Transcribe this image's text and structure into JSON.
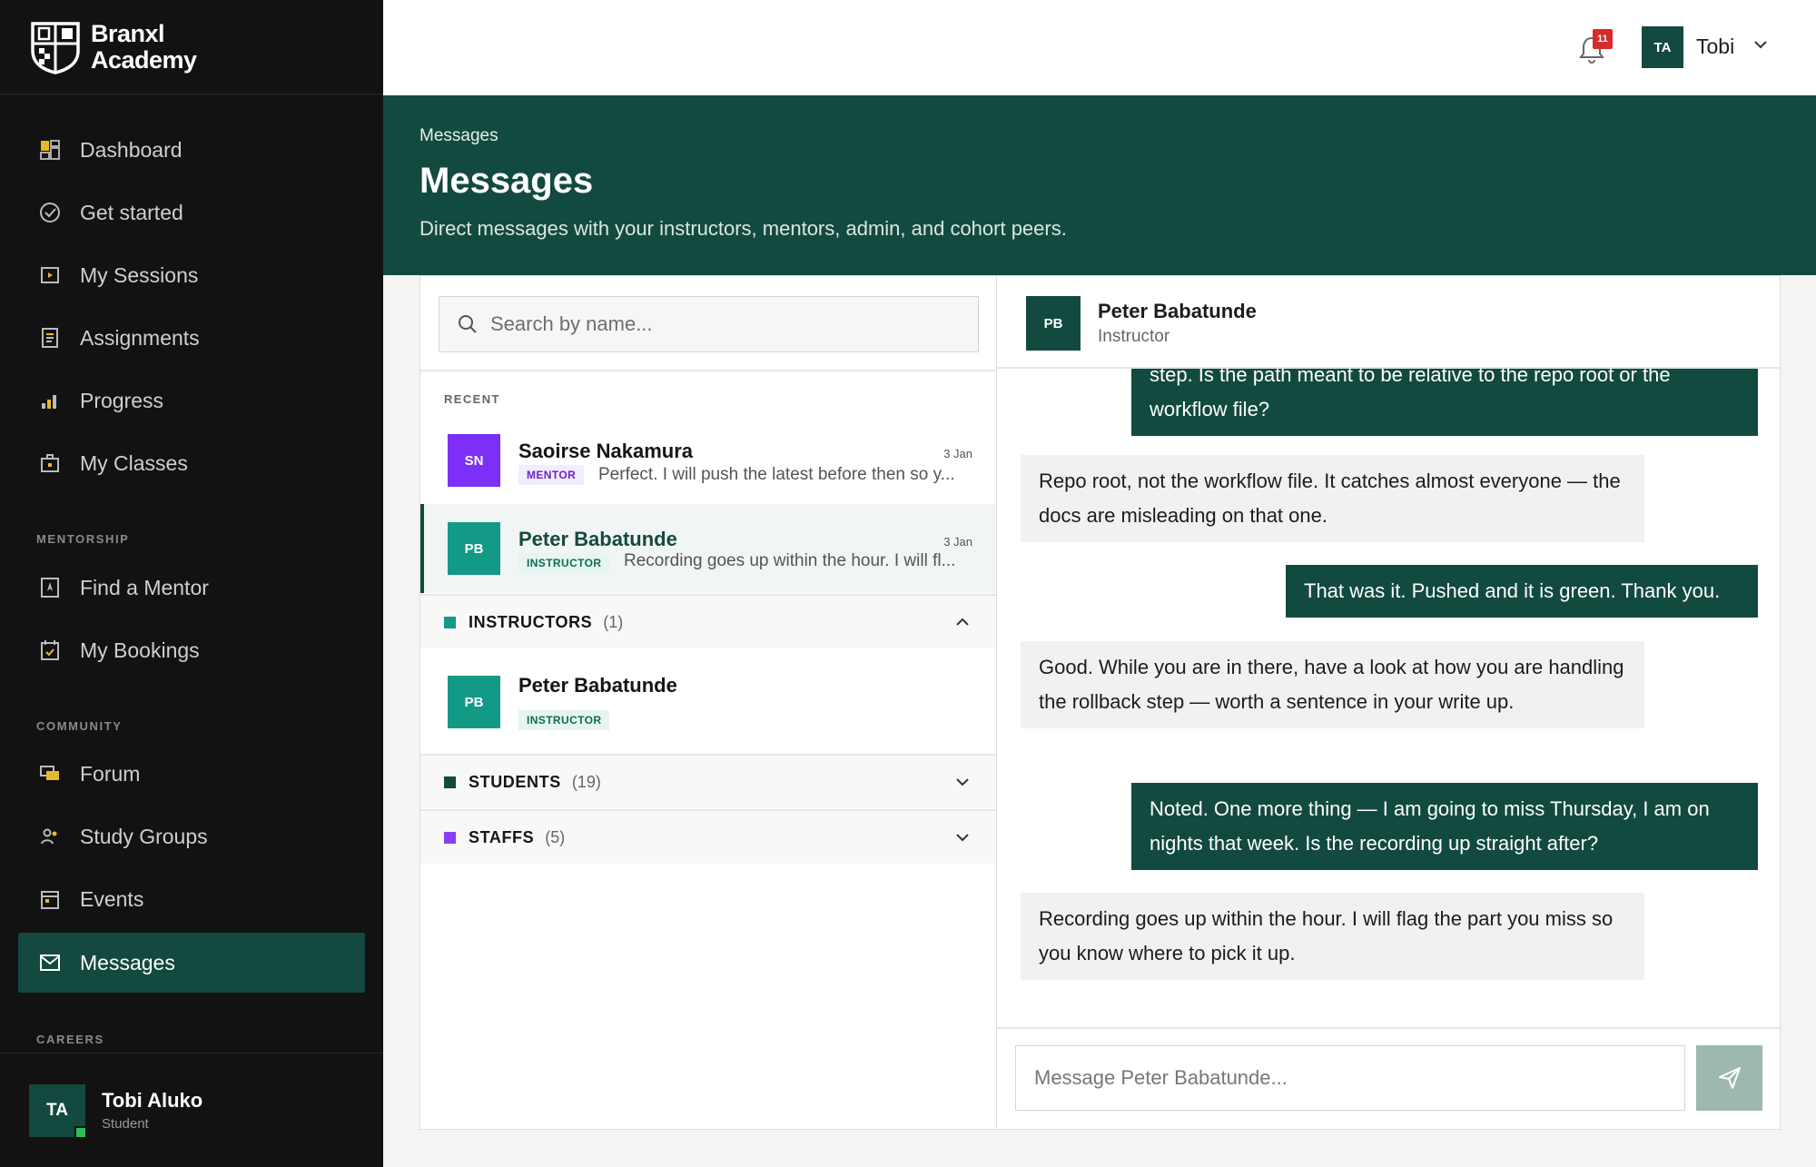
{
  "brand": {
    "line1": "Branxl",
    "line2": "Academy"
  },
  "sidebar": {
    "items": [
      {
        "label": "Dashboard",
        "icon": "dashboard-icon"
      },
      {
        "label": "Get started",
        "icon": "check-circle-icon"
      },
      {
        "label": "My Sessions",
        "icon": "play-icon"
      },
      {
        "label": "Assignments",
        "icon": "document-icon"
      },
      {
        "label": "Progress",
        "icon": "bar-chart-icon"
      },
      {
        "label": "My Classes",
        "icon": "briefcase-icon"
      },
      {
        "label": "Find a Mentor",
        "icon": "bookmark-person-icon"
      },
      {
        "label": "My Bookings",
        "icon": "calendar-check-icon"
      },
      {
        "label": "Forum",
        "icon": "chat-bubbles-icon"
      },
      {
        "label": "Study Groups",
        "icon": "people-icon"
      },
      {
        "label": "Events",
        "icon": "calendar-icon"
      },
      {
        "label": "Messages",
        "icon": "mail-icon",
        "active": true
      }
    ],
    "sections": {
      "mentorship": "MENTORSHIP",
      "community": "COMMUNITY",
      "careers": "CAREERS"
    },
    "user": {
      "initials": "TA",
      "name": "Tobi Aluko",
      "role": "Student"
    }
  },
  "topbar": {
    "notification_count": "11",
    "initials": "TA",
    "name": "Tobi"
  },
  "hero": {
    "breadcrumb": "Messages",
    "title": "Messages",
    "subtitle": "Direct messages with your instructors, mentors, admin, and cohort peers."
  },
  "contacts": {
    "search_placeholder": "Search by name...",
    "recent_label": "RECENT",
    "recent": [
      {
        "initials": "SN",
        "name": "Saoirse Nakamura",
        "date": "3 Jan",
        "role": "MENTOR",
        "preview": "Perfect. I will push the latest before then so y...",
        "color": "#7b2ff7"
      },
      {
        "initials": "PB",
        "name": "Peter Babatunde",
        "date": "3 Jan",
        "role": "INSTRUCTOR",
        "preview": "Recording goes up within the hour. I will fl...",
        "color": "#139a86",
        "selected": true
      }
    ],
    "groups": [
      {
        "name": "INSTRUCTORS",
        "count": "(1)",
        "color": "#139a86",
        "expanded": true,
        "members": [
          {
            "initials": "PB",
            "name": "Peter Babatunde",
            "role": "INSTRUCTOR"
          }
        ]
      },
      {
        "name": "STUDENTS",
        "count": "(19)",
        "color": "#134a3f",
        "expanded": false
      },
      {
        "name": "STAFFS",
        "count": "(5)",
        "color": "#8a3ff2",
        "expanded": false
      }
    ]
  },
  "chat": {
    "header": {
      "initials": "PB",
      "name": "Peter Babatunde",
      "role": "Instructor"
    },
    "messages": [
      {
        "direction": "out",
        "text": "step. Is the path meant to be relative to the repo root or the workflow file?"
      },
      {
        "direction": "in",
        "text": "Repo root, not the workflow file. It catches almost everyone — the docs are misleading on that one."
      },
      {
        "direction": "out",
        "text": "That was it. Pushed and it is green. Thank you."
      },
      {
        "direction": "in",
        "text": "Good. While you are in there, have a look at how you are handling the rollback step — worth a sentence in your write up."
      },
      {
        "direction": "out",
        "text": "Noted. One more thing — I am going to miss Thursday, I am on nights that week. Is the recording up straight after?"
      },
      {
        "direction": "in",
        "text": "Recording goes up within the hour. I will flag the part you miss so you know where to pick it up."
      }
    ],
    "composer_placeholder": "Message Peter Babatunde..."
  }
}
